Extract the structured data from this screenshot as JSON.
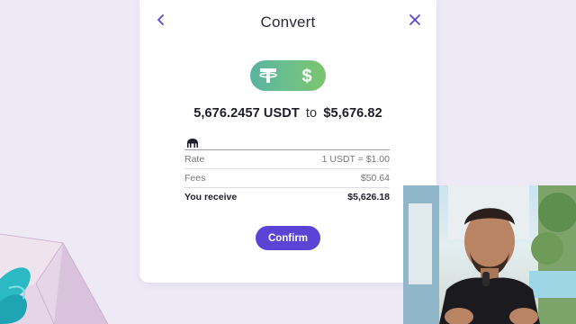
{
  "dialog": {
    "title": "Convert",
    "from_amount": "5,676.2457 USDT",
    "connector": "to",
    "to_amount": "$5,676.82",
    "rows": [
      {
        "label": "Rate",
        "value": "1 USDT = $1.00"
      },
      {
        "label": "Fees",
        "value": "$50.64"
      },
      {
        "label": "You receive",
        "value": "$5,626.18"
      }
    ],
    "confirm_label": "Confirm"
  },
  "icons": {
    "back": "chevron-left-icon",
    "close": "close-icon",
    "from_coin": "tether-icon",
    "to_coin": "dollar-icon",
    "exchange": "kraken-logo-icon"
  },
  "colors": {
    "accent": "#5b43d6",
    "background": "#edeaf6",
    "coin_gradient_start": "#58b4a0",
    "coin_gradient_end": "#7bc56e"
  }
}
